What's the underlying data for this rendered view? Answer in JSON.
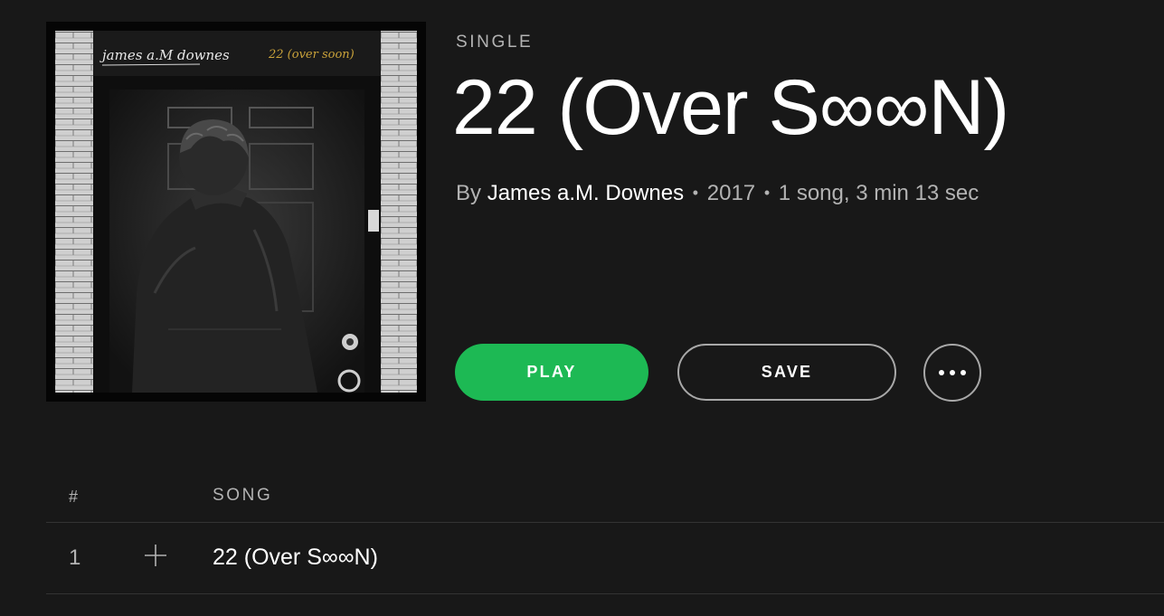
{
  "album": {
    "type_label": "SINGLE",
    "title": "22 (Over S∞∞N)",
    "by_prefix": "By",
    "artist": "James a.M. Downes",
    "year": "2017",
    "summary": "1 song, 3 min 13 sec",
    "separator": "•",
    "cover_text": {
      "artist_handwriting": "james a.M downes",
      "title_handwriting": "22 (over soon)"
    }
  },
  "actions": {
    "play_label": "PLAY",
    "save_label": "SAVE",
    "more_icon": "more-horizontal-icon"
  },
  "tracklist": {
    "headers": {
      "number": "#",
      "song": "SONG"
    },
    "rows": [
      {
        "number": "1",
        "title": "22 (Over S∞∞N)",
        "add_icon": "plus-icon"
      }
    ]
  },
  "colors": {
    "background": "#181818",
    "accent": "#1db954",
    "secondary_text": "#b3b3b3",
    "divider": "#333333"
  }
}
